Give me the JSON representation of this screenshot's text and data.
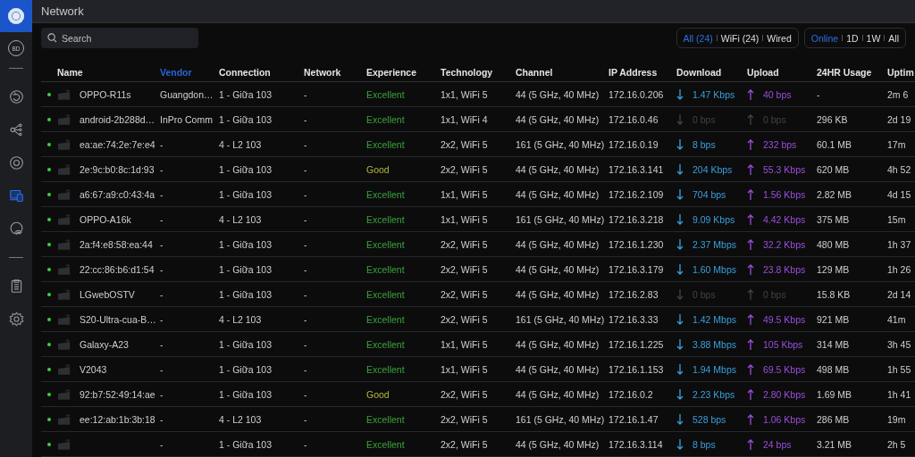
{
  "window": {
    "title": "Network"
  },
  "sidebar": {
    "avatar": "BD",
    "groups": [
      [
        {
          "kind": "rotate",
          "selected": false
        },
        {
          "kind": "nodes",
          "selected": false
        },
        {
          "kind": "target",
          "selected": false
        },
        {
          "kind": "devices",
          "selected": true
        },
        {
          "kind": "wifi",
          "selected": false
        }
      ],
      [
        {
          "kind": "clipboard",
          "selected": false
        },
        {
          "kind": "settings",
          "selected": false
        }
      ]
    ]
  },
  "search": {
    "placeholder": "Search"
  },
  "filters": [
    [
      {
        "label": "All (24)",
        "selected": true
      },
      {
        "label": "WiFi (24)",
        "selected": false
      },
      {
        "label": "Wired",
        "selected": false
      }
    ],
    [
      {
        "label": "Online",
        "selected": true
      },
      {
        "label": "1D",
        "selected": false
      },
      {
        "label": "1W",
        "selected": false
      },
      {
        "label": "All",
        "selected": false
      }
    ]
  ],
  "table": {
    "columns": [
      {
        "label": "Name",
        "sorted": false
      },
      {
        "label": "Vendor",
        "sorted": true
      },
      {
        "label": "Connection",
        "sorted": false
      },
      {
        "label": "Network",
        "sorted": false
      },
      {
        "label": "Experience",
        "sorted": false
      },
      {
        "label": "Technology",
        "sorted": false
      },
      {
        "label": "Channel",
        "sorted": false
      },
      {
        "label": "IP Address",
        "sorted": false
      },
      {
        "label": "Download",
        "sorted": false
      },
      {
        "label": "Upload",
        "sorted": false
      },
      {
        "label": "24HR Usage",
        "sorted": false
      },
      {
        "label": "Uptim",
        "sorted": false
      }
    ],
    "rows": [
      {
        "online": true,
        "name": "OPPO-R11s",
        "vendor": "Guangdon…",
        "connection": "1 - Giữa 103",
        "network": "-",
        "experience": {
          "text": "Excellent",
          "color": "#3aa33a"
        },
        "technology": "1x1, WiFi 5",
        "channel": "44 (5 GHz, 40 MHz)",
        "ip": "172.16.0.206",
        "download": {
          "text": "1.47 Kbps",
          "active": true
        },
        "upload": {
          "text": "40 bps",
          "active": true
        },
        "usage": "-",
        "uptime": "2m 6"
      },
      {
        "online": true,
        "name": "android-2b288d…",
        "vendor": "InPro Comm",
        "connection": "1 - Giữa 103",
        "network": "-",
        "experience": {
          "text": "Excellent",
          "color": "#3aa33a"
        },
        "technology": "1x1, WiFi 4",
        "channel": "44 (5 GHz, 40 MHz)",
        "ip": "172.16.0.46",
        "download": {
          "text": "0 bps",
          "active": false
        },
        "upload": {
          "text": "0 bps",
          "active": false
        },
        "usage": "296 KB",
        "uptime": "2d 19"
      },
      {
        "online": true,
        "name": "ea:ae:74:2e:7e:e4",
        "vendor": "-",
        "connection": "4 - L2 103",
        "network": "-",
        "experience": {
          "text": "Excellent",
          "color": "#3aa33a"
        },
        "technology": "2x2, WiFi 5",
        "channel": "161 (5 GHz, 40 MHz)",
        "ip": "172.16.0.19",
        "download": {
          "text": "8 bps",
          "active": true
        },
        "upload": {
          "text": "232 bps",
          "active": true
        },
        "usage": "60.1 MB",
        "uptime": "17m"
      },
      {
        "online": true,
        "name": "2e:9c:b0:8c:1d:93",
        "vendor": "-",
        "connection": "1 - Giữa 103",
        "network": "-",
        "experience": {
          "text": "Good",
          "color": "#b5b83a"
        },
        "technology": "2x2, WiFi 5",
        "channel": "44 (5 GHz, 40 MHz)",
        "ip": "172.16.3.141",
        "download": {
          "text": "204 Kbps",
          "active": true
        },
        "upload": {
          "text": "55.3 Kbps",
          "active": true
        },
        "usage": "620 MB",
        "uptime": "4h 52"
      },
      {
        "online": true,
        "name": "a6:67:a9:c0:43:4a",
        "vendor": "-",
        "connection": "1 - Giữa 103",
        "network": "-",
        "experience": {
          "text": "Excellent",
          "color": "#3aa33a"
        },
        "technology": "1x1, WiFi 5",
        "channel": "44 (5 GHz, 40 MHz)",
        "ip": "172.16.2.109",
        "download": {
          "text": "704 bps",
          "active": true
        },
        "upload": {
          "text": "1.56 Kbps",
          "active": true
        },
        "usage": "2.82 MB",
        "uptime": "4d 15"
      },
      {
        "online": true,
        "name": "OPPO-A16k",
        "vendor": "-",
        "connection": "4 - L2 103",
        "network": "-",
        "experience": {
          "text": "Excellent",
          "color": "#3aa33a"
        },
        "technology": "1x1, WiFi 5",
        "channel": "161 (5 GHz, 40 MHz)",
        "ip": "172.16.3.218",
        "download": {
          "text": "9.09 Kbps",
          "active": true
        },
        "upload": {
          "text": "4.42 Kbps",
          "active": true
        },
        "usage": "375 MB",
        "uptime": "15m"
      },
      {
        "online": true,
        "name": "2a:f4:e8:58:ea:44",
        "vendor": "-",
        "connection": "1 - Giữa 103",
        "network": "-",
        "experience": {
          "text": "Excellent",
          "color": "#3aa33a"
        },
        "technology": "2x2, WiFi 5",
        "channel": "44 (5 GHz, 40 MHz)",
        "ip": "172.16.1.230",
        "download": {
          "text": "2.37 Mbps",
          "active": true
        },
        "upload": {
          "text": "32.2 Kbps",
          "active": true
        },
        "usage": "480 MB",
        "uptime": "1h 37"
      },
      {
        "online": true,
        "name": "22:cc:86:b6:d1:54",
        "vendor": "-",
        "connection": "1 - Giữa 103",
        "network": "-",
        "experience": {
          "text": "Excellent",
          "color": "#3aa33a"
        },
        "technology": "2x2, WiFi 5",
        "channel": "44 (5 GHz, 40 MHz)",
        "ip": "172.16.3.179",
        "download": {
          "text": "1.60 Mbps",
          "active": true
        },
        "upload": {
          "text": "23.8 Kbps",
          "active": true
        },
        "usage": "129 MB",
        "uptime": "1h 26"
      },
      {
        "online": true,
        "name": "LGwebOSTV",
        "vendor": "-",
        "connection": "1 - Giữa 103",
        "network": "-",
        "experience": {
          "text": "Excellent",
          "color": "#3aa33a"
        },
        "technology": "2x2, WiFi 5",
        "channel": "44 (5 GHz, 40 MHz)",
        "ip": "172.16.2.83",
        "download": {
          "text": "0 bps",
          "active": false
        },
        "upload": {
          "text": "0 bps",
          "active": false
        },
        "usage": "15.8 KB",
        "uptime": "2d 14"
      },
      {
        "online": true,
        "name": "S20-Ultra-cua-B…",
        "vendor": "-",
        "connection": "4 - L2 103",
        "network": "-",
        "experience": {
          "text": "Excellent",
          "color": "#3aa33a"
        },
        "technology": "2x2, WiFi 5",
        "channel": "161 (5 GHz, 40 MHz)",
        "ip": "172.16.3.33",
        "download": {
          "text": "1.42 Mbps",
          "active": true
        },
        "upload": {
          "text": "49.5 Kbps",
          "active": true
        },
        "usage": "921 MB",
        "uptime": "41m"
      },
      {
        "online": true,
        "name": "Galaxy-A23",
        "vendor": "-",
        "connection": "1 - Giữa 103",
        "network": "-",
        "experience": {
          "text": "Excellent",
          "color": "#3aa33a"
        },
        "technology": "1x1, WiFi 5",
        "channel": "44 (5 GHz, 40 MHz)",
        "ip": "172.16.1.225",
        "download": {
          "text": "3.88 Mbps",
          "active": true
        },
        "upload": {
          "text": "105 Kbps",
          "active": true
        },
        "usage": "314 MB",
        "uptime": "3h 45"
      },
      {
        "online": true,
        "name": "V2043",
        "vendor": "-",
        "connection": "1 - Giữa 103",
        "network": "-",
        "experience": {
          "text": "Excellent",
          "color": "#3aa33a"
        },
        "technology": "1x1, WiFi 5",
        "channel": "44 (5 GHz, 40 MHz)",
        "ip": "172.16.1.153",
        "download": {
          "text": "1.94 Mbps",
          "active": true
        },
        "upload": {
          "text": "69.5 Kbps",
          "active": true
        },
        "usage": "498 MB",
        "uptime": "1h 55"
      },
      {
        "online": true,
        "name": "92:b7:52:49:14:ae",
        "vendor": "-",
        "connection": "1 - Giữa 103",
        "network": "-",
        "experience": {
          "text": "Good",
          "color": "#b5b83a"
        },
        "technology": "2x2, WiFi 5",
        "channel": "44 (5 GHz, 40 MHz)",
        "ip": "172.16.0.2",
        "download": {
          "text": "2.23 Kbps",
          "active": true
        },
        "upload": {
          "text": "2.80 Kbps",
          "active": true
        },
        "usage": "1.69 MB",
        "uptime": "1h 41"
      },
      {
        "online": true,
        "name": "ee:12:ab:1b:3b:18",
        "vendor": "-",
        "connection": "4 - L2 103",
        "network": "-",
        "experience": {
          "text": "Excellent",
          "color": "#3aa33a"
        },
        "technology": "2x2, WiFi 5",
        "channel": "161 (5 GHz, 40 MHz)",
        "ip": "172.16.1.47",
        "download": {
          "text": "528 bps",
          "active": true
        },
        "upload": {
          "text": "1.06 Kbps",
          "active": true
        },
        "usage": "286 MB",
        "uptime": "19m"
      },
      {
        "online": true,
        "vendor": "-",
        "connection": "1 - Giữa 103",
        "network": "-",
        "experience": {
          "text": "Excellent",
          "color": "#3aa33a"
        },
        "technology": "2x2, WiFi 5",
        "channel": "44 (5 GHz, 40 MHz)",
        "ip": "172.16.3.114",
        "download": {
          "text": "8 bps",
          "active": true
        },
        "upload": {
          "text": "24 bps",
          "active": true
        },
        "usage": "3.21 MB",
        "uptime": "2h 5"
      }
    ]
  }
}
